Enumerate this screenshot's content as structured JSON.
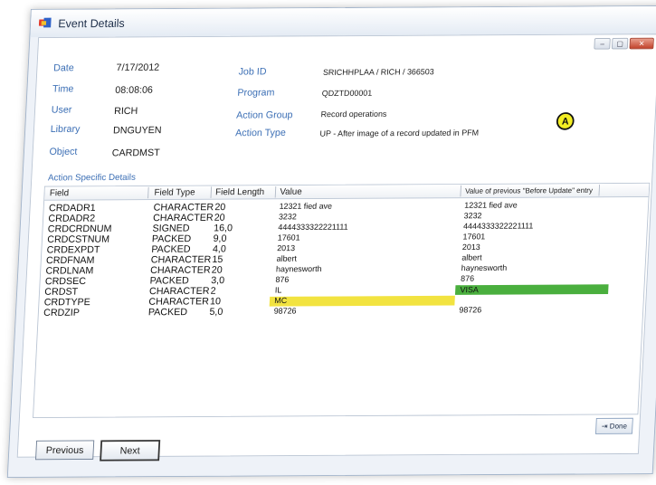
{
  "window": {
    "title": "Event Details",
    "controls": [
      "–",
      "▢",
      "✕"
    ]
  },
  "header": {
    "date_label": "Date",
    "date_value": "7/17/2012",
    "time_label": "Time",
    "time_value": "08:08:06",
    "user_label": "User",
    "user_value": "RICH",
    "library_label": "Library",
    "library_value": "DNGUYEN",
    "object_label": "Object",
    "object_value": "CARDMST",
    "jobid_label": "Job ID",
    "jobid_value": "SRICHHPLAA / RICH / 366503",
    "program_label": "Program",
    "program_value": "QDZTD00001",
    "action_group_label": "Action Group",
    "action_group_value": "Record operations",
    "action_type_label": "Action Type",
    "action_type_value": "UP - After image of a record updated in PFM",
    "badge": "A"
  },
  "details": {
    "section_label": "Action Specific Details",
    "columns": [
      "Field",
      "Field Type",
      "Field Length",
      "Value",
      "Value of previous \"Before Update\" entry"
    ],
    "rows": [
      {
        "field": "CRDADR1",
        "type": "CHARACTER",
        "length": "20",
        "value": "12321 fied ave",
        "prev": "12321 fied ave"
      },
      {
        "field": "CRDADR2",
        "type": "CHARACTER",
        "length": "20",
        "value": "3232",
        "prev": "3232"
      },
      {
        "field": "CRDCRDNUM",
        "type": "SIGNED",
        "length": "16,0",
        "value": "4444333322221111",
        "prev": "4444333322221111"
      },
      {
        "field": "CRDCSTNUM",
        "type": "PACKED",
        "length": "9,0",
        "value": "17601",
        "prev": "17601"
      },
      {
        "field": "CRDEXPDT",
        "type": "PACKED",
        "length": "4,0",
        "value": "2013",
        "prev": "2013"
      },
      {
        "field": "CRDFNAM",
        "type": "CHARACTER",
        "length": "15",
        "value": "albert",
        "prev": "albert"
      },
      {
        "field": "CRDLNAM",
        "type": "CHARACTER",
        "length": "20",
        "value": "haynesworth",
        "prev": "haynesworth"
      },
      {
        "field": "CRDSEC",
        "type": "PACKED",
        "length": "3,0",
        "value": "876",
        "prev": "876"
      },
      {
        "field": "CRDST",
        "type": "CHARACTER",
        "length": "2",
        "value": "IL",
        "prev": "IL"
      },
      {
        "field": "CRDTYPE",
        "type": "CHARACTER",
        "length": "10",
        "value": "MC",
        "prev": "VISA"
      },
      {
        "field": "CRDZIP",
        "type": "PACKED",
        "length": "5,0",
        "value": "98726",
        "prev": "98726"
      }
    ],
    "highlight_colors": {
      "changed_value": "#f2e340",
      "previous_value": "#4aaf3e"
    }
  },
  "buttons": {
    "done": "Done",
    "previous": "Previous",
    "next": "Next"
  }
}
